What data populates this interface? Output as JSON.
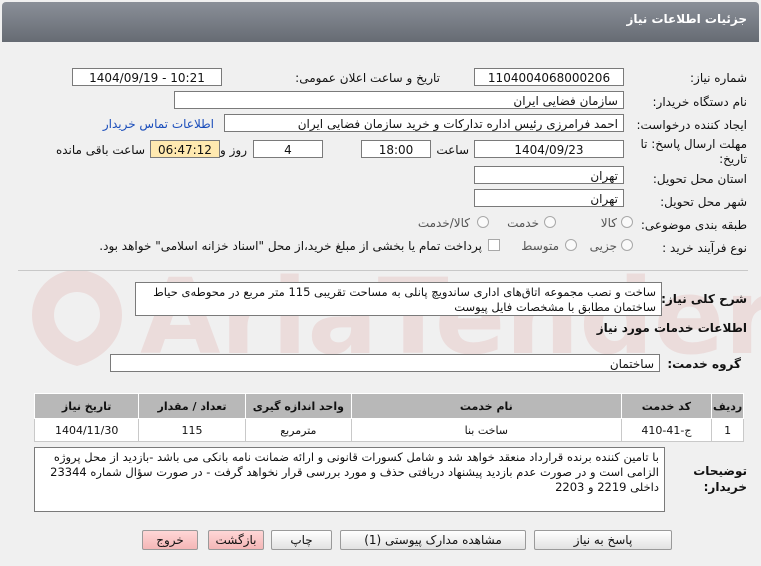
{
  "header": {
    "title": "جزئیات اطلاعات نیاز"
  },
  "fields": {
    "need_number_label": "شماره نیاز:",
    "need_number": "1104004068000206",
    "announce_label": "تاریخ و ساعت اعلان عمومی:",
    "announce_value": "1404/09/19 - 10:21",
    "buyer_org_label": "نام دستگاه خریدار:",
    "buyer_org": "سازمان فضایی ایران",
    "creator_label": "ایجاد کننده درخواست:",
    "creator": "احمد فرامرزی رئیس اداره تدارکات و خرید سازمان فضایی ایران",
    "contact_link": "اطلاعات تماس خریدار",
    "deadline_label": "مهلت ارسال پاسخ: تا تاریخ:",
    "deadline_date": "1404/09/23",
    "time_label": "ساعت",
    "deadline_time": "18:00",
    "days_value": "4",
    "days_label": "روز و",
    "remaining_time": "06:47:12",
    "remaining_label": "ساعت باقی مانده",
    "province_label": "استان محل تحویل:",
    "province": "تهران",
    "city_label": "شهر محل تحویل:",
    "city": "تهران",
    "category_label": "طبقه بندی موضوعی:",
    "category_options": [
      "کالا",
      "خدمت",
      "کالا/خدمت"
    ],
    "process_label": "نوع فرآیند خرید :",
    "process_options": [
      "جزیی",
      "متوسط"
    ],
    "payment_check_label": "پرداخت تمام یا بخشی از مبلغ خرید،از محل \"اسناد خزانه اسلامی\" خواهد بود."
  },
  "summary": {
    "label": "شرح کلی نیاز:",
    "text": "ساخت و نصب مجموعه اتاق‌های اداری ساندویچ پانلی به مساحت تقریبی 115 متر مربع در محوطه‌ی حیاط ساختمان مطابق با مشخصات فایل پیوست"
  },
  "services": {
    "title": "اطلاعات خدمات مورد نیاز",
    "group_label": "گروه خدمت:",
    "group_value": "ساختمان",
    "headers": [
      "ردیف",
      "کد خدمت",
      "نام خدمت",
      "واحد اندازه گیری",
      "تعداد / مقدار",
      "تاریخ نیاز"
    ],
    "rows": [
      [
        "1",
        "ج-41-410",
        "ساخت بنا",
        "مترمربع",
        "115",
        "1404/11/30"
      ]
    ]
  },
  "notes": {
    "label": "توضیحات خریدار:",
    "text": "با تامین کننده برنده قرارداد منعقد خواهد شد و شامل کسورات قانونی و ارائه ضمانت نامه بانکی می باشد -بازدید از محل پروژه الزامی است و در صورت عدم بازدید  پیشنهاد دریافتی حذف و  مورد بررسی قرار نخواهد گرفت - در صورت سؤال شماره 23344 داخلی 2219 و 2203"
  },
  "buttons": {
    "reply": "پاسخ به نیاز",
    "docs": "مشاهده مدارک پیوستی (1)",
    "print": "چاپ",
    "back": "بازگشت",
    "exit": "خروج"
  },
  "watermark": {
    "text": "AriaTender.neT"
  },
  "colors": {
    "header": "#787d85",
    "timer": "#ffe9b0",
    "pink_button": "#f4b7b7",
    "link": "#1a4dbb"
  }
}
